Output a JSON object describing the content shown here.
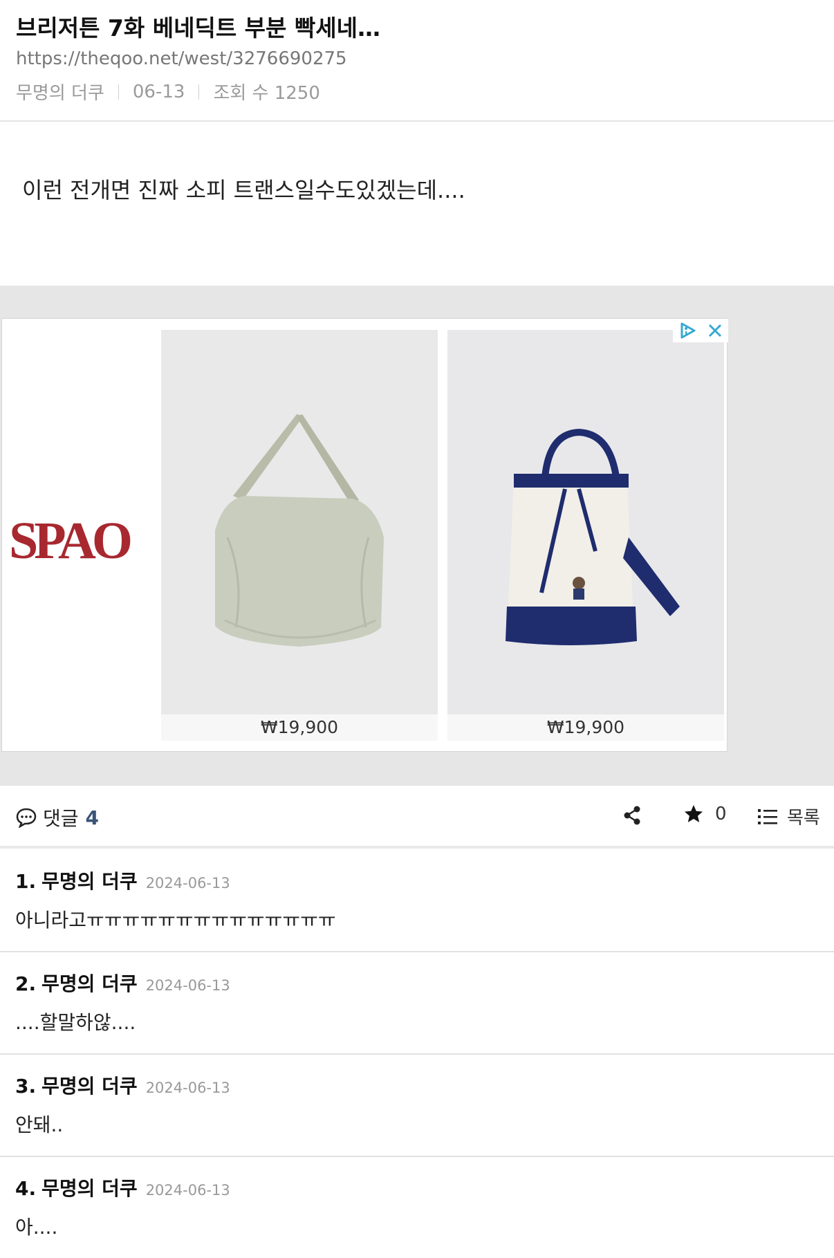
{
  "post": {
    "title": "브리저튼 7화 베네딕트 부분 빡세네…",
    "url": "https://theqoo.net/west/3276690275",
    "author": "무명의 더쿠",
    "date": "06-13",
    "views": "조회 수 1250",
    "body": "이런 전개면 진짜 소피 트랜스일수도있겠는데...."
  },
  "ad": {
    "brand": "SPAO",
    "products": [
      {
        "price": "₩19,900"
      },
      {
        "price": "₩19,900"
      }
    ],
    "icons": [
      "adchoices-icon",
      "close-icon"
    ]
  },
  "toolbar": {
    "comments_label": "댓글",
    "comments_count": "4",
    "star_count": "0",
    "list_label": "목록"
  },
  "comments": [
    {
      "num": "1.",
      "author": "무명의 더쿠",
      "date": "2024-06-13",
      "text": "아니라고ㅠㅠㅠㅠㅠㅠㅠㅠㅠㅠㅠㅠㅠㅠ"
    },
    {
      "num": "2.",
      "author": "무명의 더쿠",
      "date": "2024-06-13",
      "text": "....할말하않...."
    },
    {
      "num": "3.",
      "author": "무명의 더쿠",
      "date": "2024-06-13",
      "text": "안돼.."
    },
    {
      "num": "4.",
      "author": "무명의 더쿠",
      "date": "2024-06-13",
      "text": "아...."
    }
  ],
  "colors": {
    "brand_red": "#a82830",
    "count_blue": "#3a5476",
    "ad_bg": "#e6e6e6"
  }
}
